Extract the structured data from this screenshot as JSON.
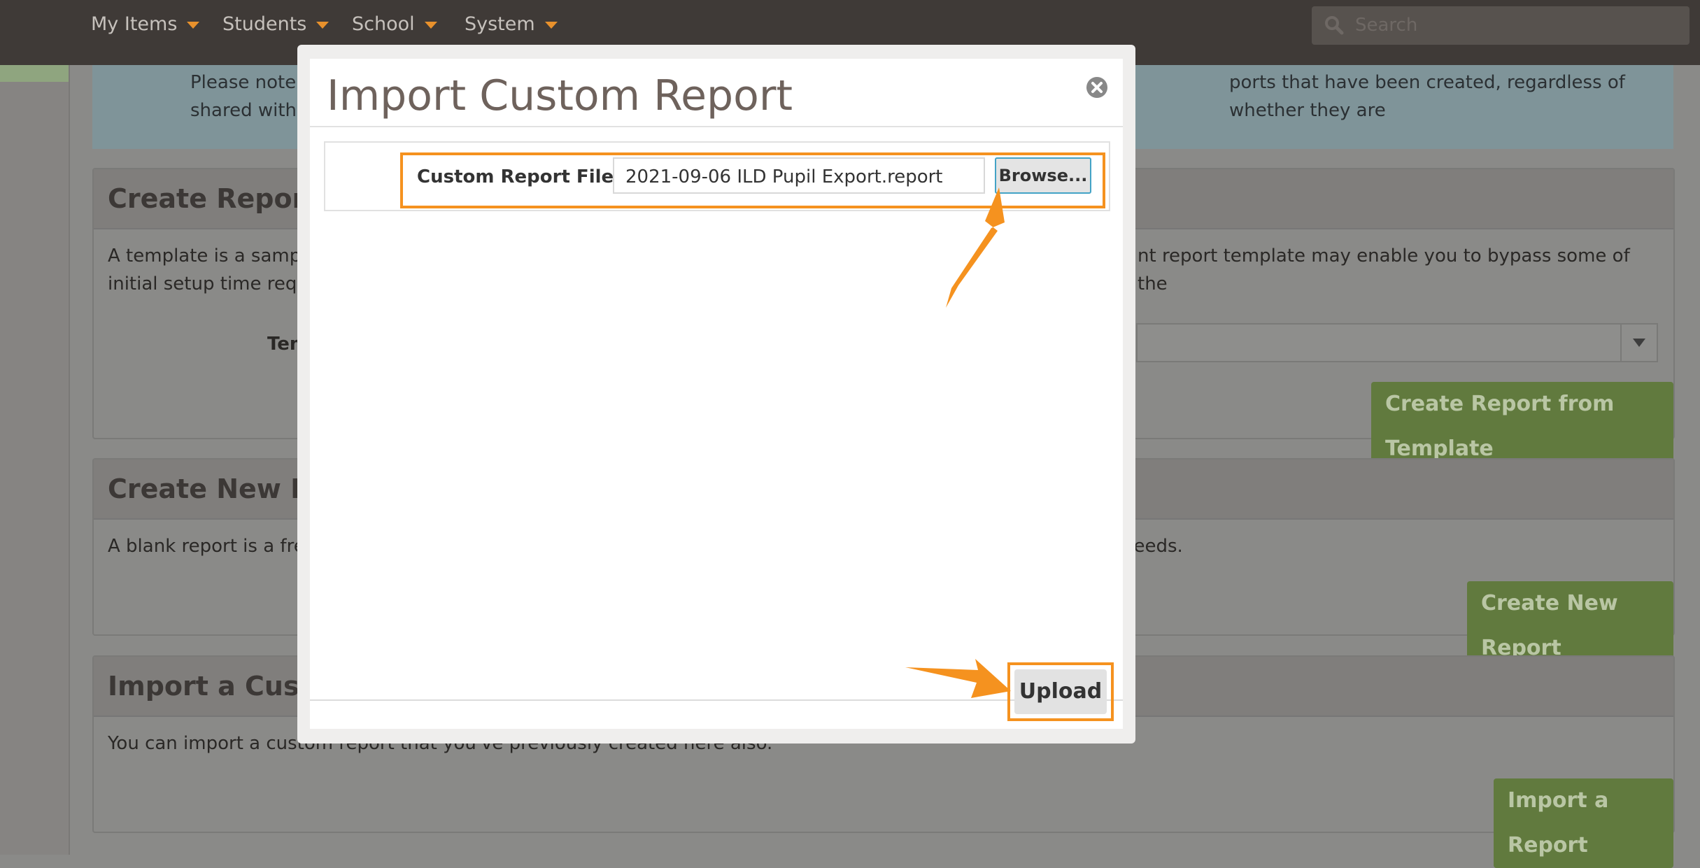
{
  "nav": {
    "items": [
      {
        "label": "My Items"
      },
      {
        "label": "Students"
      },
      {
        "label": "School"
      },
      {
        "label": "System"
      }
    ],
    "search_placeholder": "Search"
  },
  "background": {
    "notice_line1_start": "Please note t",
    "notice_line1_end": "ports that have been created, regardless of whether they are",
    "notice_line2": "shared with t",
    "template_panel": {
      "title": "Create Report fr",
      "desc_line1_start": "A template is a sample",
      "desc_line1_end": "nt report template may enable you to bypass some of the",
      "desc_line2": "initial setup time requi",
      "field_label": "Tem",
      "button": "Create Report from Template"
    },
    "new_panel": {
      "title": "Create New Rep",
      "desc_start": "A blank report is a fres",
      "desc_end": "needs.",
      "button": "Create New Report"
    },
    "import_panel": {
      "title": "Import a Custom",
      "desc": "You can import a custom report that you've previously created here also.",
      "button": "Import a Report"
    }
  },
  "modal": {
    "title": "Import Custom Report",
    "field_label": "Custom Report File*",
    "file_value": "2021-09-06 ILD Pupil Export.report",
    "browse_label": "Browse...",
    "upload_label": "Upload"
  },
  "colors": {
    "highlight": "#f5921f",
    "accent_green": "#617a3e",
    "navbar": "#3f3a37"
  }
}
